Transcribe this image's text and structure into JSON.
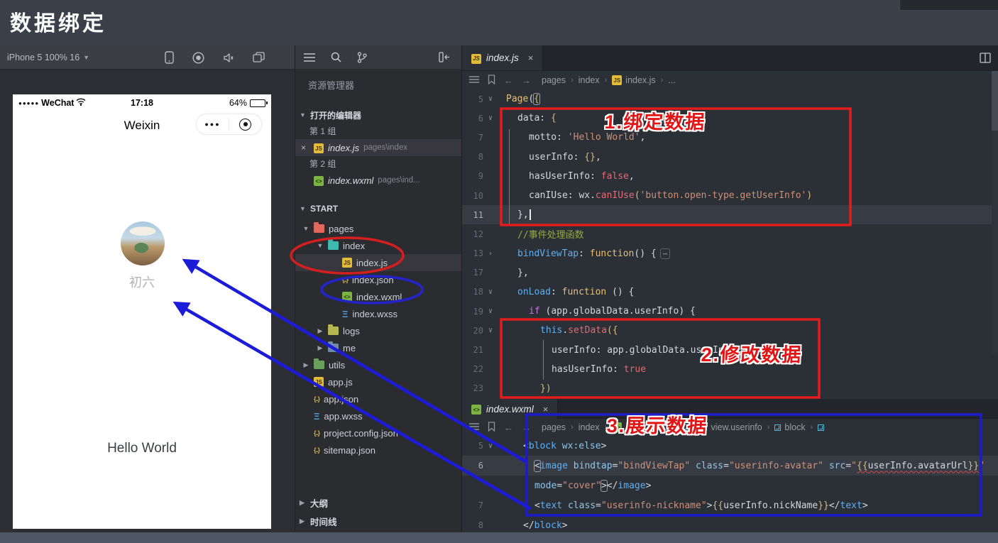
{
  "colors": {
    "annotation_red": "#e01616",
    "annotation_blue": "#1c1ccc",
    "arrow_blue": "#1b1bd8"
  },
  "slide": {
    "title": "数据绑定"
  },
  "simulator": {
    "device_label": "iPhone 5 100% 16",
    "status": {
      "dots": "●●●●●",
      "carrier": "WeChat",
      "time": "17:18",
      "battery_pct": "64%",
      "battery_fill": "64%"
    },
    "nav_title": "Weixin",
    "capsule_dots": "●●●",
    "nickname": "初六",
    "motto": "Hello World"
  },
  "explorer": {
    "title": "资源管理器",
    "sections": {
      "open_editors": "打开的编辑器",
      "project": "START",
      "outline": "大纲",
      "timeline": "时间线"
    },
    "groups": [
      {
        "label": "第 1 组",
        "file": "index.js",
        "path": "pages\\index",
        "icon": "js"
      },
      {
        "label": "第 2 组",
        "file": "index.wxml",
        "path": "pages\\ind...",
        "icon": "wxml"
      }
    ],
    "tree": [
      {
        "indent": 0,
        "arrow": "v",
        "icon": "folder",
        "color": "#e0695c",
        "label": "pages"
      },
      {
        "indent": 1,
        "arrow": "v",
        "icon": "folder",
        "color": "#3fb9af",
        "label": "index"
      },
      {
        "indent": 2,
        "icon": "js",
        "label": "index.js",
        "selected": true
      },
      {
        "indent": 2,
        "icon": "json",
        "label": "index.json"
      },
      {
        "indent": 2,
        "icon": "wxml",
        "label": "index.wxml"
      },
      {
        "indent": 2,
        "icon": "wxss",
        "label": "index.wxss"
      },
      {
        "indent": 1,
        "arrow": ">",
        "icon": "folder",
        "color": "#b3b94e",
        "label": "logs"
      },
      {
        "indent": 1,
        "arrow": ">",
        "icon": "folder",
        "color": "#7189a8",
        "label": "me"
      },
      {
        "indent": 0,
        "arrow": ">",
        "icon": "folder",
        "color": "#6ba05c",
        "label": "utils"
      },
      {
        "indent": 0,
        "icon": "js",
        "label": "app.js"
      },
      {
        "indent": 0,
        "icon": "json",
        "label": "app.json"
      },
      {
        "indent": 0,
        "icon": "wxss",
        "label": "app.wxss"
      },
      {
        "indent": 0,
        "icon": "json",
        "label": "project.config.json"
      },
      {
        "indent": 0,
        "icon": "json",
        "label": "sitemap.json"
      }
    ]
  },
  "editor_top": {
    "tab": "index.js",
    "tab_icon": "js",
    "breadcrumb": [
      {
        "label": "pages"
      },
      {
        "label": "index"
      },
      {
        "label": "index.js",
        "icon": "js"
      },
      {
        "label": "..."
      }
    ],
    "lines": [
      {
        "n": "5",
        "fold": "v",
        "ind": 0,
        "seg": [
          [
            "yellow",
            "Page"
          ],
          [
            "w",
            "("
          ],
          [
            "gold box",
            "{"
          ]
        ]
      },
      {
        "n": "6",
        "fold": "v",
        "ind": 1,
        "seg": [
          [
            "w",
            "data: "
          ],
          [
            "gold",
            "{"
          ]
        ]
      },
      {
        "n": "7",
        "ind": 2,
        "seg": [
          [
            "w",
            "motto: "
          ],
          [
            "str",
            "'Hello World'"
          ],
          [
            "w",
            ","
          ]
        ]
      },
      {
        "n": "8",
        "ind": 2,
        "seg": [
          [
            "w",
            "userInfo: "
          ],
          [
            "gold",
            "{}"
          ],
          [
            "w",
            ","
          ]
        ]
      },
      {
        "n": "9",
        "ind": 2,
        "seg": [
          [
            "w",
            "hasUserInfo: "
          ],
          [
            "red",
            "false"
          ],
          [
            "w",
            ","
          ]
        ]
      },
      {
        "n": "10",
        "ind": 2,
        "seg": [
          [
            "w",
            "canIUse: wx."
          ],
          [
            "red",
            "canIUse"
          ],
          [
            "gold",
            "("
          ],
          [
            "str",
            "'button.open-type.getUserInfo'"
          ],
          [
            "gold",
            ")"
          ]
        ]
      },
      {
        "n": "11",
        "ind": 1,
        "hl": true,
        "cursor": true,
        "seg": [
          [
            "w",
            "},"
          ]
        ]
      },
      {
        "n": "12",
        "ind": 1,
        "seg": [
          [
            "green",
            "//事件处理函数"
          ]
        ]
      },
      {
        "n": "13",
        "fold": ">",
        "ind": 1,
        "seg": [
          [
            "blue",
            "bindViewTap"
          ],
          [
            "w",
            ": "
          ],
          [
            "yellow",
            "function"
          ],
          [
            "w",
            "() {"
          ],
          [
            "dots",
            "⋯"
          ]
        ]
      },
      {
        "n": "17",
        "ind": 1,
        "seg": [
          [
            "w",
            "},"
          ]
        ]
      },
      {
        "n": "18",
        "fold": "v",
        "ind": 1,
        "seg": [
          [
            "blue",
            "onLoad"
          ],
          [
            "w",
            ": "
          ],
          [
            "yellow",
            "function"
          ],
          [
            "w",
            " () {"
          ]
        ]
      },
      {
        "n": "19",
        "fold": "v",
        "ind": 2,
        "seg": [
          [
            "purple",
            "if"
          ],
          [
            "w",
            " ("
          ],
          [
            "w",
            "app.globalData.userInfo"
          ],
          [
            "w",
            ") {"
          ]
        ]
      },
      {
        "n": "20",
        "fold": "v",
        "ind": 3,
        "seg": [
          [
            "blue",
            "this"
          ],
          [
            "w",
            "."
          ],
          [
            "red",
            "setData"
          ],
          [
            "gold",
            "({"
          ]
        ]
      },
      {
        "n": "21",
        "ind": 4,
        "seg": [
          [
            "w",
            "userInfo: app.globalData.userInfo,"
          ]
        ]
      },
      {
        "n": "22",
        "ind": 4,
        "seg": [
          [
            "w",
            "hasUserInfo: "
          ],
          [
            "red",
            "true"
          ]
        ]
      },
      {
        "n": "23",
        "ind": 3,
        "seg": [
          [
            "gold",
            "})"
          ]
        ]
      }
    ]
  },
  "editor_bottom": {
    "tab": "index.wxml",
    "tab_icon": "wxml",
    "breadcrumb": [
      {
        "label": "pages"
      },
      {
        "label": "index"
      },
      {
        "label": "index.wxml",
        "icon": "wxml"
      },
      {
        "label": "",
        "icon": "cube"
      },
      {
        "label": "view.userinfo",
        "icon": "cube"
      },
      {
        "label": "block",
        "icon": "cube"
      },
      {
        "label": "",
        "icon": "cube"
      }
    ],
    "lines": [
      {
        "n": "5",
        "fold": "v",
        "ind": 0,
        "seg": [
          [
            "w",
            "<"
          ],
          [
            "blue",
            "block"
          ],
          [
            "w",
            " "
          ],
          [
            "cyan",
            "wx:else"
          ],
          [
            "w",
            ">"
          ]
        ]
      },
      {
        "n": "6",
        "hl": true,
        "ind": 1,
        "seg": [
          [
            "w box",
            "<"
          ],
          [
            "blue",
            "image"
          ],
          [
            "w",
            " "
          ],
          [
            "cyan",
            "bindtap"
          ],
          [
            "w",
            "="
          ],
          [
            "str",
            "\"bindViewTap\""
          ],
          [
            "w",
            " "
          ],
          [
            "cyan",
            "class"
          ],
          [
            "w",
            "="
          ],
          [
            "str",
            "\"userinfo-avatar\""
          ],
          [
            "w",
            " "
          ],
          [
            "cyan",
            "src"
          ],
          [
            "w",
            "="
          ],
          [
            "str",
            "\""
          ],
          [
            "gold sq",
            "{{"
          ],
          [
            "w sq",
            "userInfo.avatarUrl"
          ],
          [
            "gold sq",
            "}}"
          ],
          [
            "str",
            "\""
          ]
        ]
      },
      {
        "n": "",
        "ind": 1,
        "seg": [
          [
            "cyan",
            "mode"
          ],
          [
            "w",
            "="
          ],
          [
            "str",
            "\"cover\""
          ],
          [
            "w box",
            ">"
          ],
          [
            "w",
            "</"
          ],
          [
            "blue",
            "image"
          ],
          [
            "w",
            ">"
          ]
        ]
      },
      {
        "n": "7",
        "ind": 1,
        "seg": [
          [
            "w",
            "<"
          ],
          [
            "blue",
            "text"
          ],
          [
            "w",
            " "
          ],
          [
            "cyan",
            "class"
          ],
          [
            "w",
            "="
          ],
          [
            "str",
            "\"userinfo-nickname\""
          ],
          [
            "w",
            ">"
          ],
          [
            "gold",
            "{{"
          ],
          [
            "w",
            "userInfo.nickName"
          ],
          [
            "gold",
            "}}"
          ],
          [
            "w",
            "</"
          ],
          [
            "blue",
            "text"
          ],
          [
            "w",
            ">"
          ]
        ]
      },
      {
        "n": "8",
        "ind": 0,
        "seg": [
          [
            "w",
            "</"
          ],
          [
            "blue",
            "block"
          ],
          [
            "w",
            ">"
          ]
        ]
      }
    ]
  },
  "annotations": {
    "step1": "1.绑定数据",
    "step2": "2.修改数据",
    "step3": "3.展示数据"
  }
}
